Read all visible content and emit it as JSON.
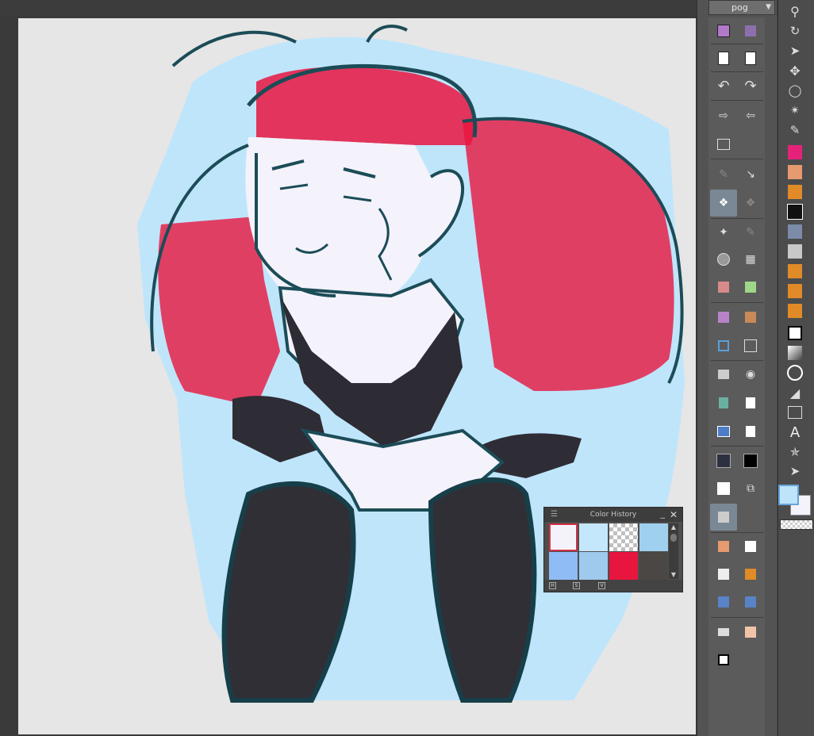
{
  "app": {
    "subtool_dropdown": "pog"
  },
  "command_bar_icons": [
    "save-icon",
    "export-png-icon",
    "new-page-icon",
    "page-icon",
    "undo-icon",
    "redo-icon",
    "export-icon",
    "import-icon",
    "layout-grid-icon",
    "erase-selection-icon",
    "transform-icon",
    "brush-stroke-icon",
    "convert-icon",
    "magic-wand-icon",
    "pen-edit-icon",
    "sphere-icon",
    "mesh-transform-icon",
    "mask-icon",
    "crop-icon",
    "layer-icon",
    "frame-icon",
    "target-icon",
    "resize-icon",
    "animation-icon",
    "camera-icon",
    "bookmark-icon",
    "document-icon",
    "grid-icon",
    "notes-icon",
    "dark-color-icon",
    "black-color-icon",
    "white-color-icon",
    "duplicate-icon",
    "film-icon",
    "pen-tool-icon",
    "marker-icon",
    "dip-pen-icon",
    "pencil-icon",
    "blend-icon",
    "tone-icon",
    "eraser-icon",
    "eraser-alt-icon",
    "fill-icon"
  ],
  "tool_palette": [
    "zoom-icon",
    "rotate-icon",
    "object-icon",
    "move-icon",
    "lasso-icon",
    "auto-select-icon",
    "eyedropper-icon",
    "pen-icon",
    "marker-tool-icon",
    "pencil-tool-icon",
    "dip-pen-tool-icon",
    "g-pen-icon",
    "airbrush-icon",
    "decoration-icon",
    "eraser-tool-icon",
    "blend-tool-icon",
    "fill-tool-icon",
    "gradient-icon",
    "figure-icon",
    "ruler-icon",
    "frame-border-icon",
    "text-icon",
    "balloon-icon",
    "correct-line-icon"
  ],
  "colors": {
    "main_color": "#bde4fb",
    "sub_color": "#f4f2fb"
  },
  "color_history": {
    "title": "Color History",
    "swatches": [
      "#f4f2fb",
      "#c5e7fb",
      "transparent",
      "#9fd1ef",
      "#8fbcf5",
      "#9fcaee",
      "#e8153f",
      "#4a4744"
    ],
    "footer_labels": [
      "H",
      "S",
      "V"
    ]
  }
}
